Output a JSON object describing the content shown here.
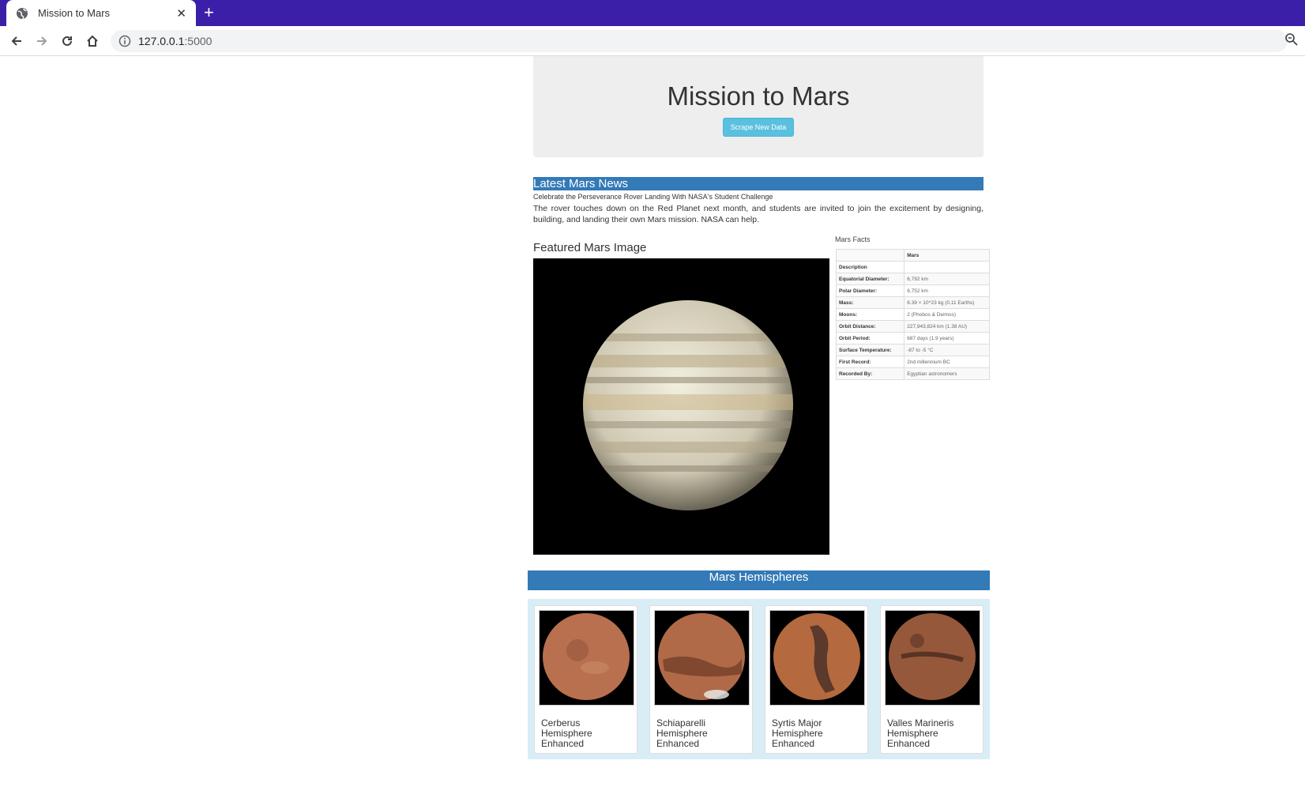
{
  "browser": {
    "tab_title": "Mission to Mars",
    "url_host": "127.0.0.1",
    "url_port": ":5000"
  },
  "jumbotron": {
    "title": "Mission to Mars",
    "button_label": "Scrape New Data"
  },
  "news": {
    "heading": "Latest Mars News",
    "title": "Celebrate the Perseverance Rover Landing With NASA's Student Challenge",
    "paragraph": "The rover touches down on the Red Planet next month, and students are invited to join the excitement by designing, building, and landing their own Mars mission. NASA can help."
  },
  "featured": {
    "heading": "Featured Mars Image"
  },
  "facts": {
    "caption": "Mars Facts",
    "column_header": "Mars",
    "rows": [
      {
        "label": "Description",
        "value": ""
      },
      {
        "label": "Equatorial Diameter:",
        "value": "6,792 km"
      },
      {
        "label": "Polar Diameter:",
        "value": "6,752 km"
      },
      {
        "label": "Mass:",
        "value": "6.39 × 10^23 kg (0.11 Earths)"
      },
      {
        "label": "Moons:",
        "value": "2 (Phobos & Deimos)"
      },
      {
        "label": "Orbit Distance:",
        "value": "227,943,824 km (1.38 AU)"
      },
      {
        "label": "Orbit Period:",
        "value": "687 days (1.9 years)"
      },
      {
        "label": "Surface Temperature:",
        "value": "-87 to -5 °C"
      },
      {
        "label": "First Record:",
        "value": "2nd millennium BC"
      },
      {
        "label": "Recorded By:",
        "value": "Egyptian astronomers"
      }
    ]
  },
  "hemispheres": {
    "heading": "Mars Hemispheres",
    "items": [
      {
        "title": "Cerberus Hemisphere Enhanced"
      },
      {
        "title": "Schiaparelli Hemisphere Enhanced"
      },
      {
        "title": "Syrtis Major Hemisphere Enhanced"
      },
      {
        "title": "Valles Marineris Hemisphere Enhanced"
      }
    ]
  }
}
